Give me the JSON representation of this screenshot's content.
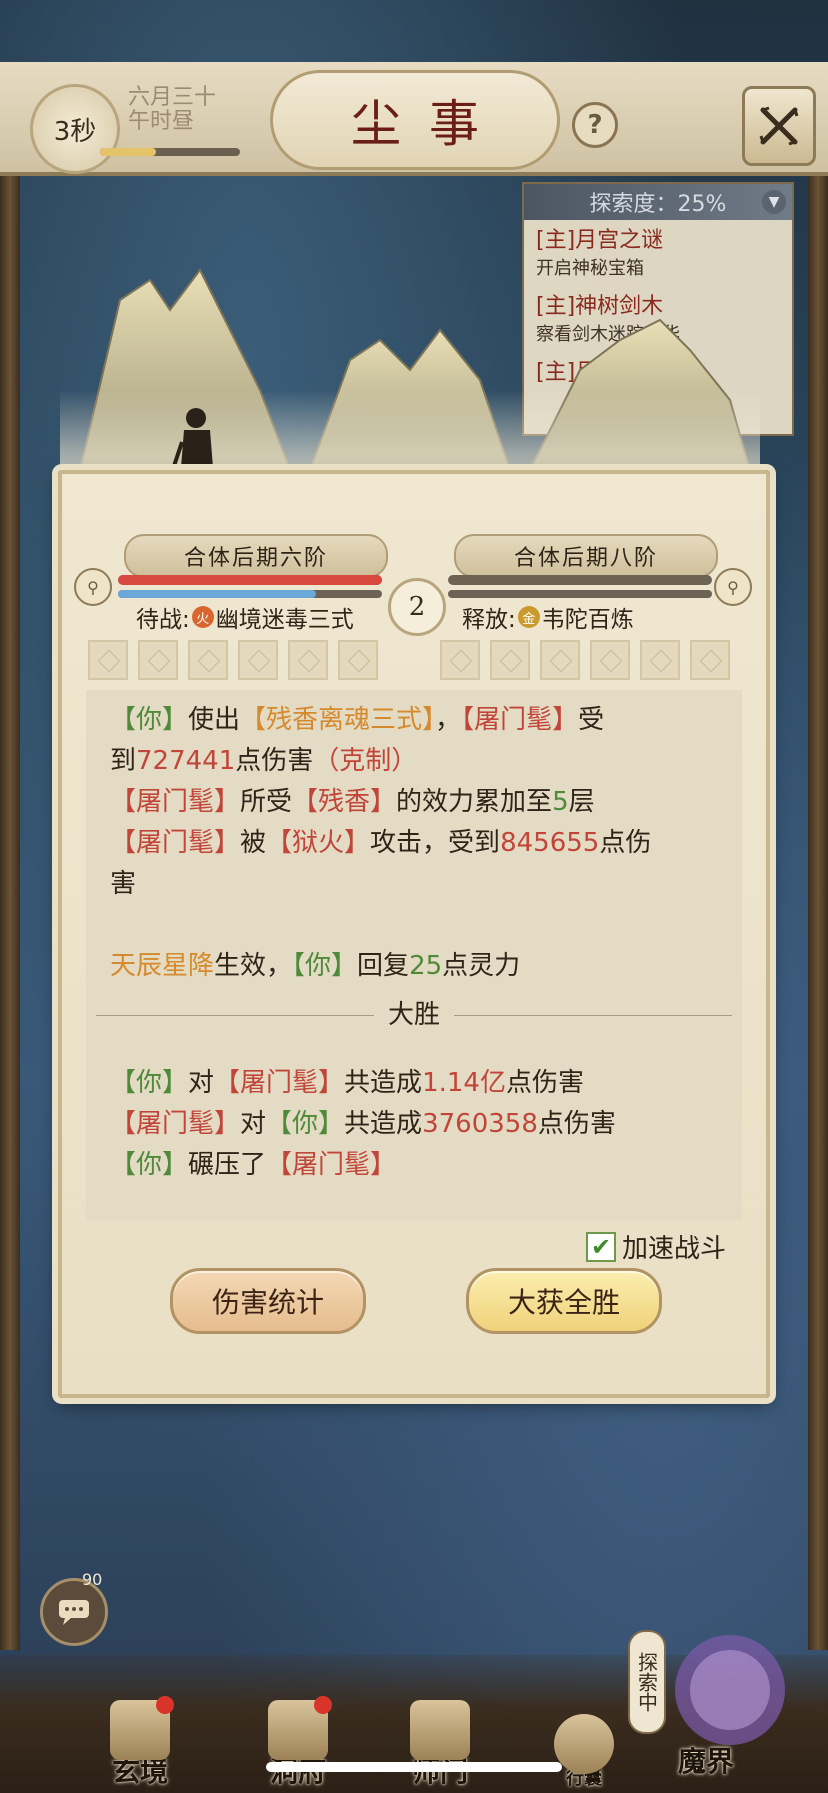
{
  "header": {
    "timer": "3秒",
    "date_line1": "六月三十",
    "date_line2": "午时昼",
    "title": "尘事",
    "help_label": "?",
    "time_progress": 0.4
  },
  "explore": {
    "header": "探索度：25%",
    "quests": [
      {
        "title": "[主]月宫之谜",
        "desc": "开启神秘宝箱"
      },
      {
        "title": "[主]神树剑木",
        "desc": "察看剑木迷踪日华"
      },
      {
        "title": "[主]月宫",
        "desc": ""
      }
    ]
  },
  "battle": {
    "left_realm": "合体后期六阶",
    "right_realm": "合体后期八阶",
    "round": "2",
    "left_skill_prefix": "待战:",
    "left_skill_badge": "火",
    "left_skill": "幽境迷毒三式",
    "right_skill_prefix": "释放:",
    "right_skill_badge": "金",
    "right_skill": "韦陀百炼",
    "left_hp": 1.0,
    "left_mp": 0.75,
    "right_hp": 0,
    "right_mp": 0
  },
  "log": {
    "l1_a": "【你】",
    "l1_b": "使出",
    "l1_c": "【残香离魂三式】",
    "l1_d": "，",
    "l1_e": "【屠门髦】",
    "l1_f": "受",
    "l2_a": "到",
    "l2_b": "727441",
    "l2_c": "点伤害",
    "l2_d": "（克制）",
    "l3_a": "【屠门髦】",
    "l3_b": "所受",
    "l3_c": "【残香】",
    "l3_d": "的效力累加至",
    "l3_e": "5",
    "l3_f": "层",
    "l4_a": "【屠门髦】",
    "l4_b": "被",
    "l4_c": "【狱火】",
    "l4_d": "攻击，受到",
    "l4_e": "845655",
    "l4_f": "点伤",
    "l5_a": "害",
    "l6_a": "天辰星降",
    "l6_b": "生效，",
    "l6_c": "【你】",
    "l6_d": "回复",
    "l6_e": "25",
    "l6_f": "点灵力",
    "result": "大胜",
    "s1_a": "【你】",
    "s1_b": "对",
    "s1_c": "【屠门髦】",
    "s1_d": "共造成",
    "s1_e": "1.14亿",
    "s1_f": "点伤害",
    "s2_a": "【屠门髦】",
    "s2_b": "对",
    "s2_c": "【你】",
    "s2_d": "共造成",
    "s2_e": "3760358",
    "s2_f": "点伤害",
    "s3_a": "【你】",
    "s3_b": "碾压了",
    "s3_c": "【屠门髦】"
  },
  "controls": {
    "accelerate_label": "加速战斗",
    "accelerate_checked": true,
    "damage_stats_button": "伤害统计",
    "victory_button": "大获全胜"
  },
  "bottom": {
    "chat_count": "90",
    "nav": [
      {
        "label": "玄境"
      },
      {
        "label": "洞府"
      },
      {
        "label": "师门"
      },
      {
        "label": "行囊"
      },
      {
        "label": "魔界"
      }
    ],
    "explore_tag": "探索中"
  }
}
